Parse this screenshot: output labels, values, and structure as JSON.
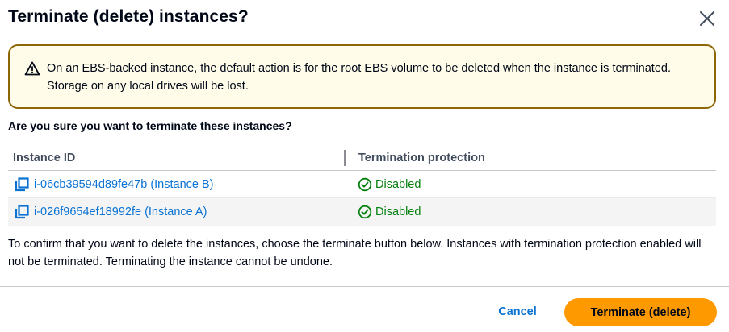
{
  "dialog": {
    "title": "Terminate (delete) instances?",
    "close_icon": "close-icon"
  },
  "warning": {
    "icon": "warning-triangle-icon",
    "text": "On an EBS-backed instance, the default action is for the root EBS volume to be deleted when the instance is terminated. Storage on any local drives will be lost."
  },
  "question": "Are you sure you want to terminate these instances?",
  "table": {
    "columns": [
      "Instance ID",
      "Termination protection"
    ],
    "rows": [
      {
        "instance_id": "i-06cb39594d89fe47b (Instance B)",
        "protection": "Disabled"
      },
      {
        "instance_id": "i-026f9654ef18992fe (Instance A)",
        "protection": "Disabled"
      }
    ]
  },
  "confirm_text": "To confirm that you want to delete the instances, choose the terminate button below. Instances with termination protection enabled will not be terminated. Terminating the instance cannot be undone.",
  "footer": {
    "cancel_label": "Cancel",
    "terminate_label": "Terminate (delete)"
  },
  "colors": {
    "link": "#0972d3",
    "success": "#037f0c",
    "warning_border": "#8d6605",
    "warning_bg": "#fffce9",
    "primary": "#ff9900"
  }
}
